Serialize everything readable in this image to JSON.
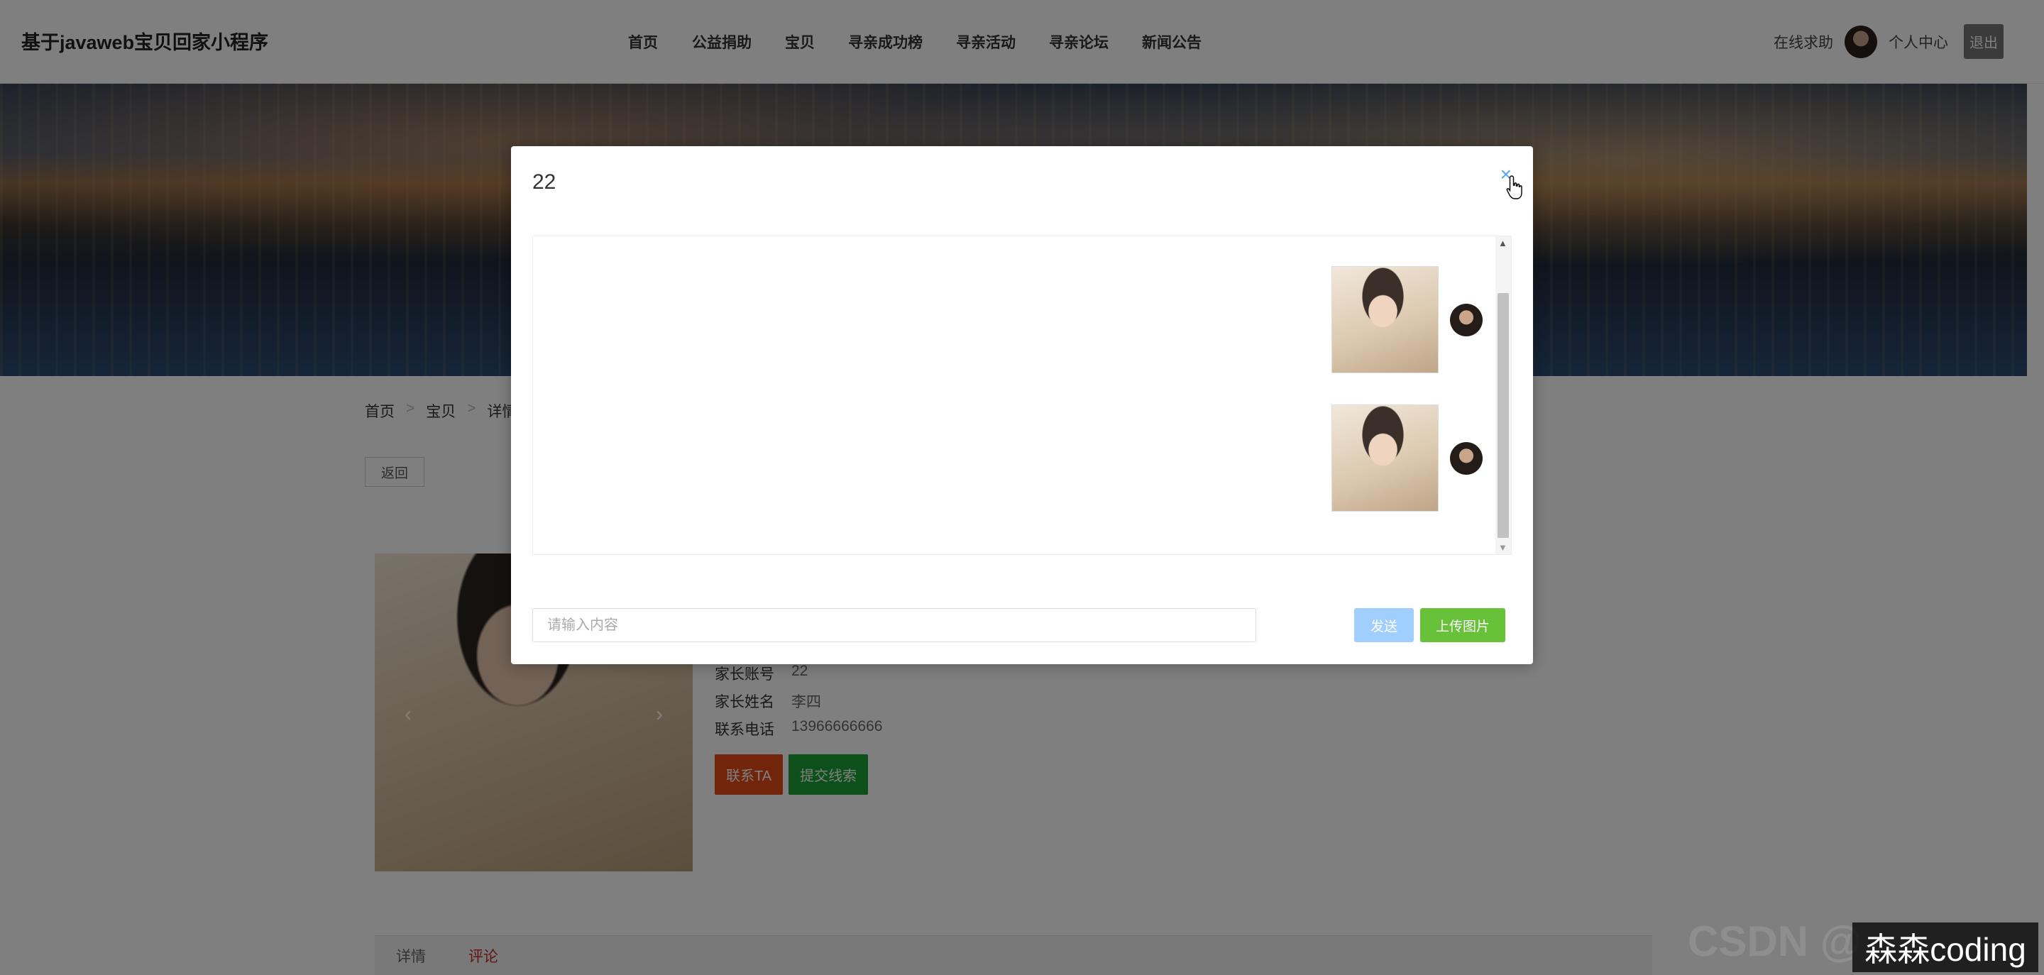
{
  "header": {
    "site_title": "基于javaweb宝贝回家小程序",
    "nav": [
      "首页",
      "公益捐助",
      "宝贝",
      "寻亲成功榜",
      "寻亲活动",
      "寻亲论坛",
      "新闻公告"
    ],
    "help_link": "在线求助",
    "profile_link": "个人中心",
    "logout_label": "退出"
  },
  "breadcrumb": [
    "首页",
    "宝贝",
    "详情"
  ],
  "breadcrumb_sep": ">",
  "back_label": "返回",
  "details": [
    {
      "label": "家长账号",
      "value": "22"
    },
    {
      "label": "家长姓名",
      "value": "李四"
    },
    {
      "label": "联系电话",
      "value": "13966666666"
    }
  ],
  "actions": {
    "contact": "联系TA",
    "clue": "提交线索"
  },
  "tabs": [
    "详情",
    "评论"
  ],
  "modal": {
    "title": "22",
    "close_icon": "×",
    "input_placeholder": "请输入内容",
    "send_label": "发送",
    "upload_label": "上传图片",
    "messages": [
      {
        "type": "image"
      },
      {
        "type": "image"
      }
    ]
  },
  "watermarks": {
    "csdn": "CSDN @",
    "author": "森森coding"
  },
  "colors": {
    "contact_button": "#e64a19",
    "clue_button": "#1aa038",
    "send_button": "#a0cfff",
    "upload_button": "#67c23a",
    "close_icon": "#5aa7e6",
    "active_tab": "#c62828"
  }
}
